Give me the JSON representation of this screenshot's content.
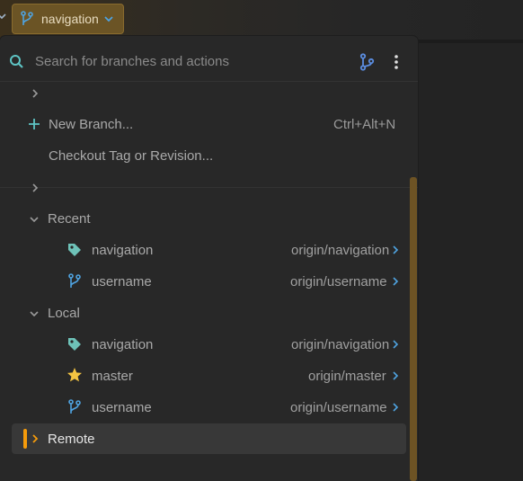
{
  "topbar": {
    "branch_label": "navigation"
  },
  "search": {
    "placeholder": "Search for branches and actions"
  },
  "actions": {
    "new_branch_label": "New Branch...",
    "new_branch_shortcut": "Ctrl+Alt+N",
    "checkout_label": "Checkout Tag or Revision..."
  },
  "groups": {
    "recent": {
      "label": "Recent",
      "items": [
        {
          "icon": "tag-icon",
          "name": "navigation",
          "remote": "origin/navigation"
        },
        {
          "icon": "branch-icon",
          "name": "username",
          "remote": "origin/username"
        }
      ]
    },
    "local": {
      "label": "Local",
      "items": [
        {
          "icon": "tag-icon",
          "name": "navigation",
          "remote": "origin/navigation"
        },
        {
          "icon": "star-icon",
          "name": "master",
          "remote": "origin/master"
        },
        {
          "icon": "branch-icon",
          "name": "username",
          "remote": "origin/username"
        }
      ]
    },
    "remote": {
      "label": "Remote"
    }
  },
  "colors": {
    "accent_orange": "#f59b0b",
    "branch_blue": "#4fa3e0",
    "tag_teal": "#6ec2b8",
    "star_yellow": "#f5c542"
  }
}
